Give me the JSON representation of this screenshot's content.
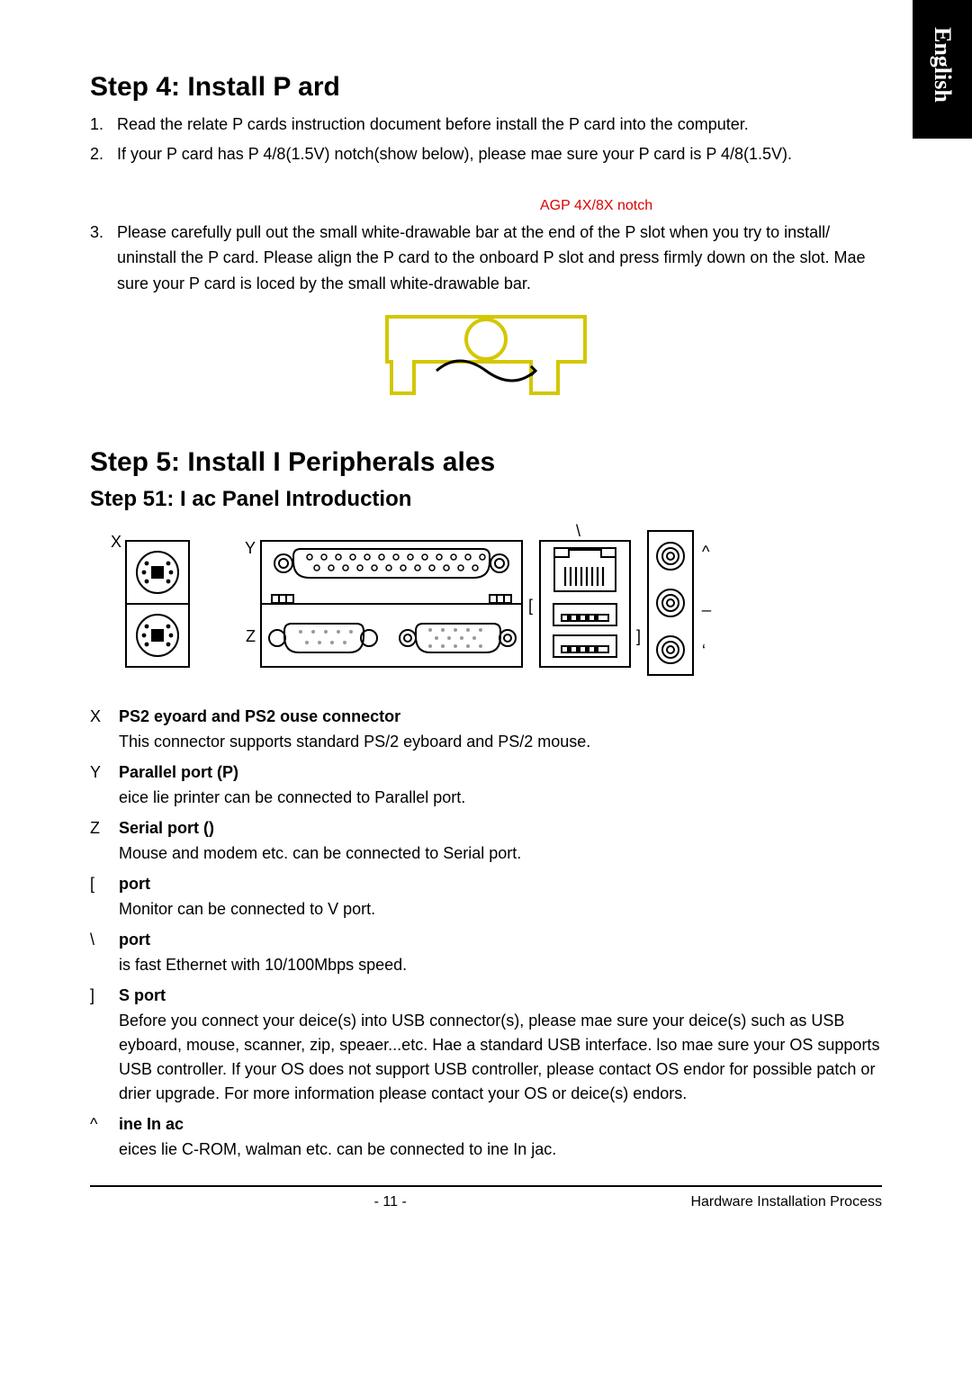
{
  "langTab": "English",
  "step4": {
    "title": "Step 4: Install P ard",
    "items": [
      {
        "num": "1.",
        "text": "Read the relate P cards instruction document before install the P card into the computer."
      },
      {
        "num": "2.",
        "text": "If your P card has P 4/8(1.5V) notch(show below), please mae sure your P card is P 4/8(1.5V)."
      }
    ],
    "notchLabel": "AGP 4X/8X notch",
    "item3": {
      "num": "3.",
      "text": "Please carefully pull out the small white-drawable bar at the end of the P slot when you try to install/ uninstall the P card. Please align the P card to the onboard P slot and press firmly down on the slot. Mae sure your P card is loced by the small white-drawable bar."
    }
  },
  "step5": {
    "title": "Step 5: Install I Peripherals ales",
    "subtitle": "Step 51: I ac Panel Introduction"
  },
  "panelLabels": {
    "X": "X",
    "Y": "Y",
    "Z": "Z",
    "br1": "[",
    "bs": "\\",
    "br2": "]",
    "caret": "^",
    "dash": "_",
    "apos": "‘"
  },
  "ports": [
    {
      "sym": "X",
      "title": "PS2 eyoard and PS2 ouse connector",
      "desc": "This connector supports standard PS/2 eyboard and PS/2 mouse."
    },
    {
      "sym": "Y",
      "title": "Parallel port (P)",
      "desc": "eice lie printer can be connected to Parallel port."
    },
    {
      "sym": "Z",
      "title": "Serial port ()",
      "desc": "Mouse and modem etc. can be connected to Serial port."
    },
    {
      "sym": "[",
      "title": "port",
      "desc": "Monitor can be connected to V port."
    },
    {
      "sym": "\\",
      "title": "port",
      "desc": "is fast Ethernet with 10/100Mbps speed."
    },
    {
      "sym": "]",
      "title": "S port",
      "desc": "Before you connect your deice(s) into USB connector(s), please mae sure your deice(s) such as USB eyboard, mouse, scanner, zip, speaer...etc. Hae a standard USB interface. lso mae sure your OS supports USB controller. If your OS does not support USB controller, please contact OS endor for possible patch or drier upgrade. For more information please contact your OS or deice(s) endors."
    },
    {
      "sym": "^",
      "title": "ine In ac",
      "desc": "eices lie C-ROM, walman etc. can be connected to ine In jac."
    }
  ],
  "footer": {
    "page": "- 11 -",
    "section": "Hardware Installation Process"
  }
}
